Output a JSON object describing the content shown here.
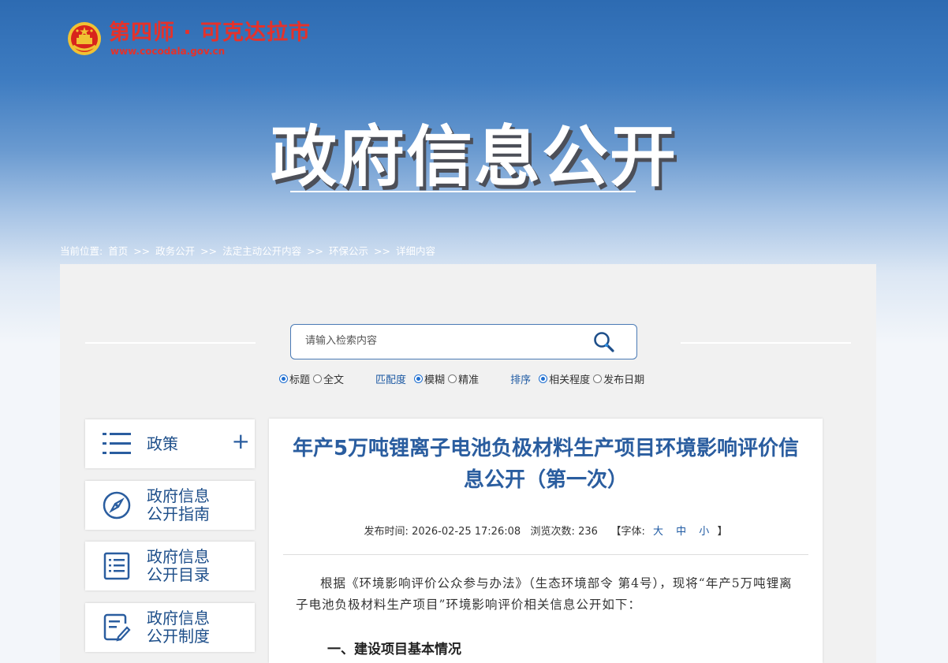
{
  "header": {
    "site_name": "第四师 · 可克达拉市",
    "site_url": "www.cocodala.gov.cn",
    "page_title": "政府信息公开"
  },
  "breadcrumb": {
    "prefix": "当前位置:",
    "items": [
      "首页",
      ">>",
      "政务公开",
      ">>",
      "法定主动公开内容",
      ">>",
      "环保公示",
      ">>",
      "详细内容"
    ]
  },
  "search": {
    "placeholder": "请输入检索内容",
    "options": {
      "scope_title": "标题",
      "scope_full": "全文",
      "match_label": "匹配度",
      "match_fuzzy": "模糊",
      "match_exact": "精准",
      "sort_label": "排序",
      "sort_relevance": "相关程度",
      "sort_date": "发布日期"
    }
  },
  "sidebar": {
    "items": [
      {
        "label": "政策",
        "icon": "list-icon",
        "expand": "+"
      },
      {
        "label": "政府信息公开指南",
        "line1": "政府信息",
        "line2": "公开指南",
        "icon": "compass-icon"
      },
      {
        "label": "政府信息公开目录",
        "line1": "政府信息",
        "line2": "公开目录",
        "icon": "catalog-icon"
      },
      {
        "label": "政府信息公开制度",
        "line1": "政府信息",
        "line2": "公开制度",
        "icon": "document-edit-icon"
      }
    ]
  },
  "article": {
    "title": "年产5万吨锂离子电池负极材料生产项目环境影响评价信息公开（第一次）",
    "publish_label": "发布时间:",
    "publish_time": "2026-02-25 17:26:08",
    "views_label": "浏览次数:",
    "views": "236",
    "font_label": "【字体:",
    "font_large": "大",
    "font_medium": "中",
    "font_small": "小",
    "font_close": "】",
    "paragraph1": "根据《环境影响评价公众参与办法》（生态环境部令 第4号），现将“年产5万吨锂离子电池负极材料生产项目”环境影响评价相关信息公开如下：",
    "section1": "一、建设项目基本情况"
  },
  "colors": {
    "brand_red": "#e4322b",
    "accent_blue": "#2a5d9f",
    "banner_blue": "#2d6bb2"
  }
}
